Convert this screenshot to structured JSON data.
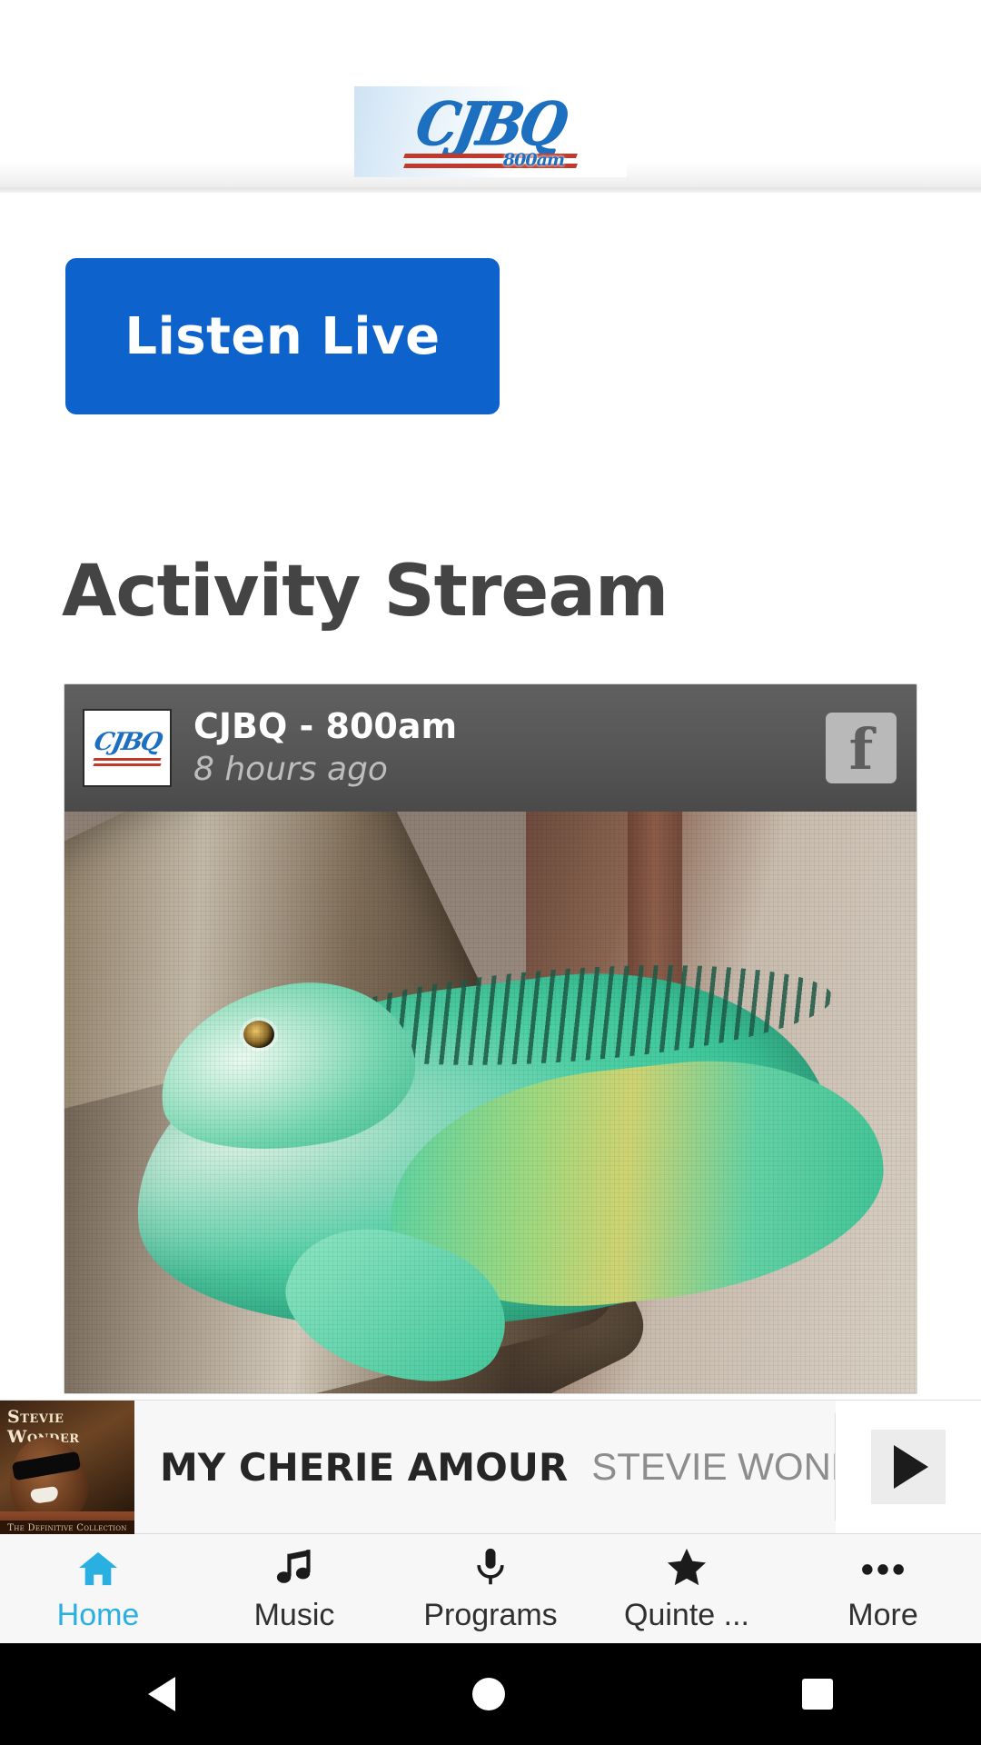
{
  "header": {
    "logo_main": "CJBQ",
    "logo_sub": "800am",
    "logo_name": "cjbq-logo"
  },
  "main": {
    "listen_live_label": "Listen Live",
    "section_title": "Activity Stream",
    "accent_blue": "#0d62cc",
    "heading_color": "#444444"
  },
  "activity_post": {
    "author": "CJBQ - 800am",
    "timestamp": "8 hours ago",
    "avatar_main": "CJBQ",
    "source_icon": "facebook-icon",
    "source_glyph": "f",
    "image_alt": "green iguana on a tree branch"
  },
  "player": {
    "track_title": "MY CHERIE AMOUR",
    "artist": "STEVIE WONDER",
    "album_artist_caption": "Stevie Wonder",
    "album_strip_caption": "The Definitive Collection",
    "play_icon": "play-icon"
  },
  "tabs": [
    {
      "label": "Home",
      "icon": "home-icon",
      "active": true
    },
    {
      "label": "Music",
      "icon": "music-note-icon",
      "active": false
    },
    {
      "label": "Programs",
      "icon": "microphone-icon",
      "active": false
    },
    {
      "label": "Quinte ...",
      "icon": "star-icon",
      "active": false
    },
    {
      "label": "More",
      "icon": "ellipsis-icon",
      "active": false
    }
  ],
  "tab_active_color": "#29b0e0",
  "system_nav": {
    "back": "back-icon",
    "home": "home-circle-icon",
    "recents": "recents-square-icon"
  }
}
